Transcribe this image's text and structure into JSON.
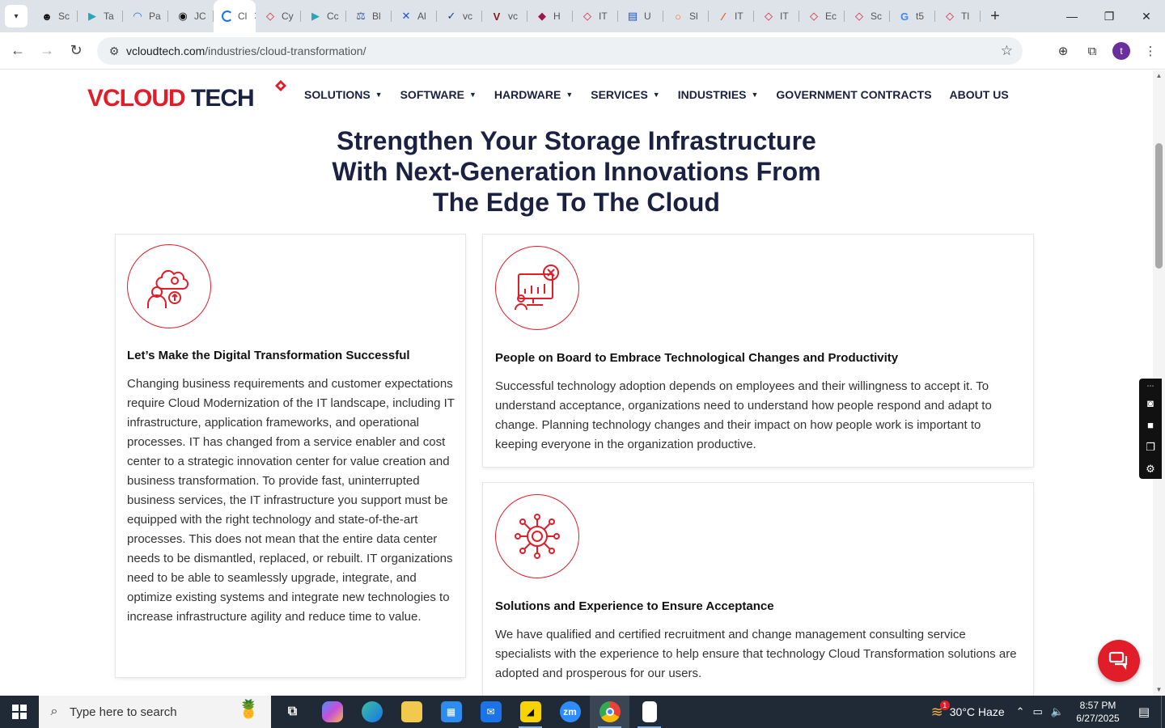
{
  "browser": {
    "tabs": [
      {
        "label": "Sc",
        "fav_color": "#111111",
        "fav_glyph": "☻"
      },
      {
        "label": "Ta",
        "fav_color": "#2aa5b8",
        "fav_glyph": "▶"
      },
      {
        "label": "Pa",
        "fav_color": "#1a73e8",
        "fav_glyph": "◠"
      },
      {
        "label": "JC",
        "fav_color": "#111111",
        "fav_glyph": "◉"
      },
      {
        "label": "Cl",
        "fav_color": "#ffffff",
        "fav_glyph": "",
        "active": true
      },
      {
        "label": "Cy",
        "fav_color": "#e11d2a",
        "fav_glyph": "◇"
      },
      {
        "label": "Cc",
        "fav_color": "#2aa5b8",
        "fav_glyph": "▶"
      },
      {
        "label": "Bl",
        "fav_color": "#3b5998",
        "fav_glyph": "⚖"
      },
      {
        "label": "Al",
        "fav_color": "#1d4ed8",
        "fav_glyph": "✕"
      },
      {
        "label": "vc",
        "fav_color": "#1e3a8a",
        "fav_glyph": "✓"
      },
      {
        "label": "vc",
        "fav_color": "#7f1d1d",
        "fav_glyph": "V"
      },
      {
        "label": "H",
        "fav_color": "#9d174d",
        "fav_glyph": "◆"
      },
      {
        "label": "IT",
        "fav_color": "#e11d2a",
        "fav_glyph": "◇"
      },
      {
        "label": "U",
        "fav_color": "#1d4ed8",
        "fav_glyph": "▤"
      },
      {
        "label": "Sl",
        "fav_color": "#f97316",
        "fav_glyph": "○"
      },
      {
        "label": "IT",
        "fav_color": "#ea580c",
        "fav_glyph": "∕"
      },
      {
        "label": "IT",
        "fav_color": "#e11d2a",
        "fav_glyph": "◇"
      },
      {
        "label": "Ec",
        "fav_color": "#e11d2a",
        "fav_glyph": "◇"
      },
      {
        "label": "Sc",
        "fav_color": "#e11d2a",
        "fav_glyph": "◇"
      },
      {
        "label": "t5",
        "fav_color": "#4285f4",
        "fav_glyph": "G"
      },
      {
        "label": "Tl",
        "fav_color": "#e11d2a",
        "fav_glyph": "◇"
      }
    ],
    "url_host": "vcloudtech.com",
    "url_path": "/industries/cloud-transformation/",
    "profile_initial": "t"
  },
  "site": {
    "logo": {
      "part1": "V",
      "part2": "CLOUD",
      "part3": " TECH"
    },
    "nav": [
      {
        "label": "SOLUTIONS",
        "dropdown": true
      },
      {
        "label": "SOFTWARE",
        "dropdown": true
      },
      {
        "label": "HARDWARE",
        "dropdown": true
      },
      {
        "label": "SERVICES",
        "dropdown": true
      },
      {
        "label": "INDUSTRIES",
        "dropdown": true
      },
      {
        "label": "GOVERNMENT CONTRACTS",
        "dropdown": false
      },
      {
        "label": "ABOUT US",
        "dropdown": false
      }
    ],
    "headline_line1": "Strengthen Your Storage Infrastructure",
    "headline_line2": "With Next-Generation Innovations From",
    "headline_line3": "The Edge To The Cloud",
    "cards": [
      {
        "title": "Let’s Make the Digital Transformation Successful",
        "body": "Changing business requirements and customer expectations require Cloud Modernization of the IT landscape, including IT infrastructure, application frameworks, and operational processes. IT has changed from a service enabler and cost center to a strategic innovation center for value creation and business transformation. To provide fast, uninterrupted business services, the IT infrastructure you support must be equipped with the right technology and state-of-the-art processes. This does not mean that the entire data center needs to be dismantled, replaced, or rebuilt. IT organizations need to be able to seamlessly upgrade, integrate, and optimize existing systems and integrate new technologies to increase infrastructure agility and reduce time to value."
      },
      {
        "title": "People on Board to Embrace Technological Changes and Productivity",
        "body": "Successful technology adoption depends on employees and their willingness to accept it. To understand acceptance, organizations need to understand how people respond and adapt to change. Planning technology changes and their impact on how people work is important to keeping everyone in the organization productive."
      },
      {
        "title": "Solutions and Experience to Ensure Acceptance",
        "body": "We have qualified and certified recruitment and change management consulting service specialists with the experience to help ensure that technology Cloud Transformation solutions are adopted and prosperous for our users."
      }
    ],
    "accent_color": "#e11d2a",
    "navy_color": "#1b2140"
  },
  "taskbar": {
    "search_placeholder": "Type here to search",
    "weather": "30°C  Haze",
    "weather_badge": "1",
    "time": "8:57 PM",
    "date": "6/27/2025",
    "apps": [
      "task-view",
      "copilot",
      "edge",
      "file-explorer",
      "store",
      "mail",
      "sticky-notes",
      "zoom",
      "chrome",
      "notepad"
    ],
    "zoom_label": "zm"
  }
}
